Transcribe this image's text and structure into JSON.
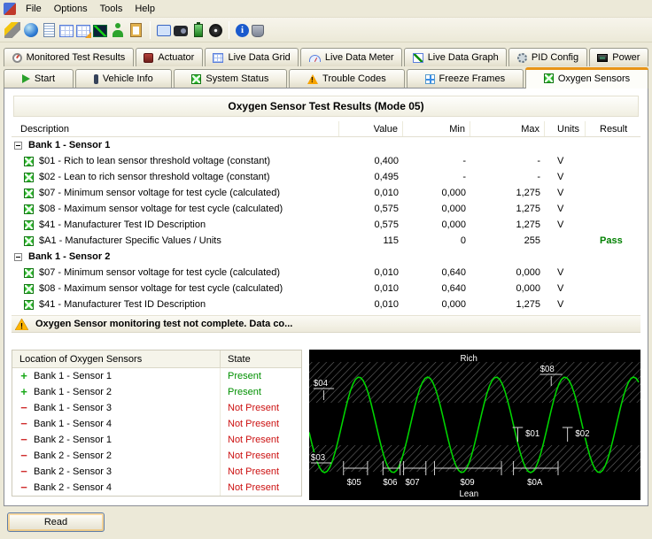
{
  "menu": {
    "items": [
      "File",
      "Options",
      "Tools",
      "Help"
    ]
  },
  "toolbar": {
    "groups": [
      [
        "connect-icon",
        "globe-icon",
        "report-icon",
        "data-grid-icon",
        "grid-edit-icon",
        "chart-icon",
        "user-icon",
        "clipboard-icon"
      ],
      [
        "screen-icon",
        "video-icon",
        "battery-icon",
        "disc-icon"
      ],
      [
        "info-icon",
        "device-icon"
      ]
    ]
  },
  "tabs_row1": [
    {
      "label": "Monitored Test Results",
      "icon": "gauge-icon"
    },
    {
      "label": "Actuator",
      "icon": "actuator-icon"
    },
    {
      "label": "Live Data Grid",
      "icon": "live-grid-icon"
    },
    {
      "label": "Live Data Meter",
      "icon": "live-meter-icon"
    },
    {
      "label": "Live Data Graph",
      "icon": "live-graph-icon"
    },
    {
      "label": "PID Config",
      "icon": "pid-config-icon"
    },
    {
      "label": "Power",
      "icon": "power-chip-icon"
    }
  ],
  "tabs_row2": [
    {
      "label": "Start",
      "icon": "start-icon"
    },
    {
      "label": "Vehicle Info",
      "icon": "vehicle-info-icon"
    },
    {
      "label": "System Status",
      "icon": "system-status-icon"
    },
    {
      "label": "Trouble Codes",
      "icon": "trouble-codes-icon"
    },
    {
      "label": "Freeze Frames",
      "icon": "freeze-frames-icon"
    },
    {
      "label": "Oxygen Sensors",
      "icon": "oxygen-sensors-icon",
      "active": true
    }
  ],
  "results": {
    "title": "Oxygen Sensor Test Results (Mode 05)",
    "columns": [
      "Description",
      "Value",
      "Min",
      "Max",
      "Units",
      "Result"
    ],
    "groups": [
      {
        "label": "Bank 1 - Sensor 1",
        "rows": [
          {
            "desc": "$01 - Rich to lean sensor threshold voltage (constant)",
            "value": "0,400",
            "min": "-",
            "max": "-",
            "units": "V",
            "result": ""
          },
          {
            "desc": "$02 - Lean to rich sensor threshold voltage (constant)",
            "value": "0,495",
            "min": "-",
            "max": "-",
            "units": "V",
            "result": ""
          },
          {
            "desc": "$07 - Minimum sensor voltage for test cycle (calculated)",
            "value": "0,010",
            "min": "0,000",
            "max": "1,275",
            "units": "V",
            "result": ""
          },
          {
            "desc": "$08 - Maximum sensor voltage for test cycle (calculated)",
            "value": "0,575",
            "min": "0,000",
            "max": "1,275",
            "units": "V",
            "result": ""
          },
          {
            "desc": "$41 - Manufacturer Test ID Description",
            "value": "0,575",
            "min": "0,000",
            "max": "1,275",
            "units": "V",
            "result": ""
          },
          {
            "desc": "$A1 - Manufacturer Specific Values / Units",
            "value": "115",
            "min": "0",
            "max": "255",
            "units": "",
            "result": "Pass"
          }
        ]
      },
      {
        "label": "Bank 1 - Sensor 2",
        "rows": [
          {
            "desc": "$07 - Minimum sensor voltage for test cycle (calculated)",
            "value": "0,010",
            "min": "0,640",
            "max": "0,000",
            "units": "V",
            "result": ""
          },
          {
            "desc": "$08 - Maximum sensor voltage for test cycle (calculated)",
            "value": "0,010",
            "min": "0,640",
            "max": "0,000",
            "units": "V",
            "result": ""
          },
          {
            "desc": "$41 - Manufacturer Test ID Description",
            "value": "0,010",
            "min": "0,000",
            "max": "1,275",
            "units": "V",
            "result": ""
          }
        ]
      }
    ],
    "warning": "Oxygen Sensor monitoring test not complete. Data co..."
  },
  "locations": {
    "columns": [
      "Location of Oxygen Sensors",
      "State"
    ],
    "rows": [
      {
        "label": "Bank 1 - Sensor 1",
        "state": "Present",
        "present": true
      },
      {
        "label": "Bank 1 - Sensor 2",
        "state": "Present",
        "present": true
      },
      {
        "label": "Bank 1 - Sensor 3",
        "state": "Not Present",
        "present": false
      },
      {
        "label": "Bank 1 - Sensor 4",
        "state": "Not Present",
        "present": false
      },
      {
        "label": "Bank 2 - Sensor 1",
        "state": "Not Present",
        "present": false
      },
      {
        "label": "Bank 2 - Sensor 2",
        "state": "Not Present",
        "present": false
      },
      {
        "label": "Bank 2 - Sensor 3",
        "state": "Not Present",
        "present": false
      },
      {
        "label": "Bank 2 - Sensor 4",
        "state": "Not Present",
        "present": false
      }
    ]
  },
  "graph": {
    "rich": "Rich",
    "lean": "Lean",
    "l01": "$01",
    "l02": "$02",
    "l03": "$03",
    "l04": "$04",
    "l05": "$05",
    "l06": "$06",
    "l07": "$07",
    "l08": "$08",
    "l09": "$09",
    "l0a": "$0A"
  },
  "read_button": {
    "label": "Read"
  },
  "colors": {
    "accent": "#e89417",
    "pass": "#008000",
    "present": "#009000",
    "absent": "#cc1111",
    "wave": "#00d600"
  }
}
